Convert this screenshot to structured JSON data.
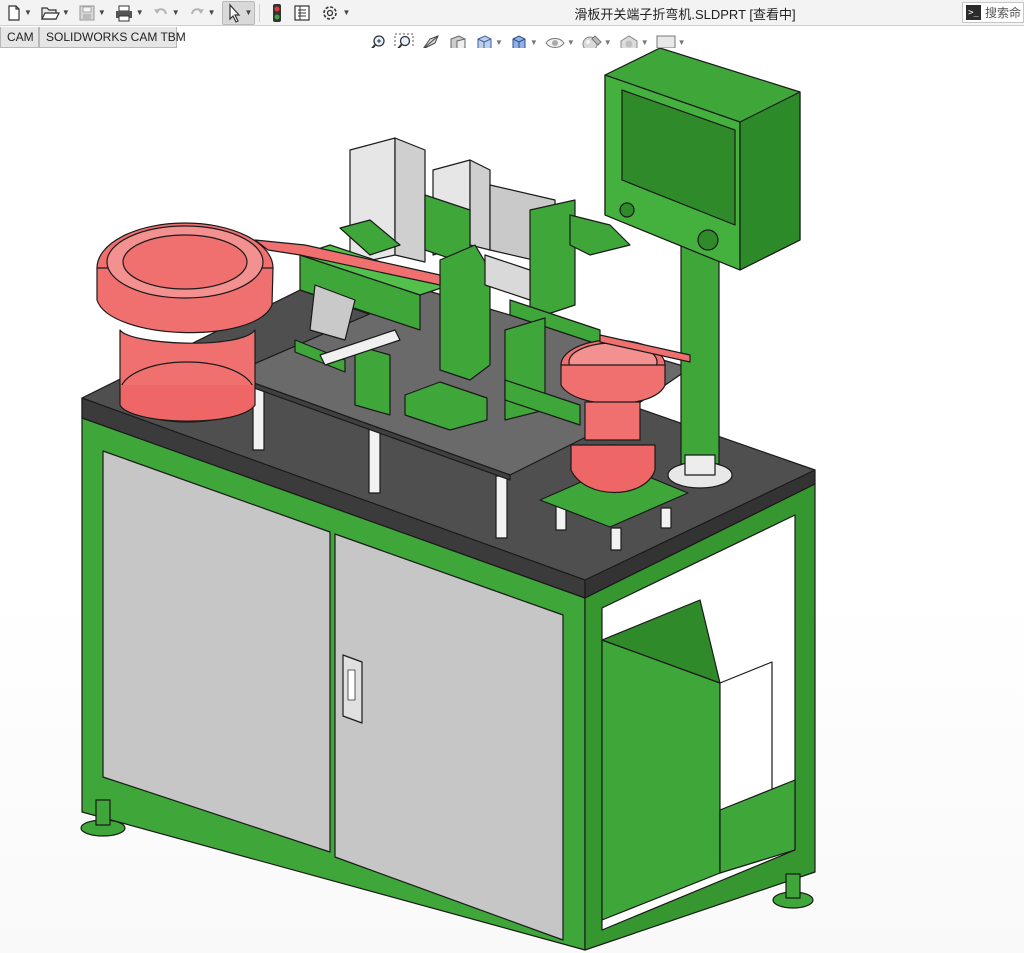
{
  "window": {
    "document_title": "滑板开关端子折弯机.SLDPRT [查看中]"
  },
  "search": {
    "placeholder": "搜索命"
  },
  "quick_access": [
    {
      "name": "new-document-icon"
    },
    {
      "name": "open-document-icon"
    },
    {
      "name": "save-icon"
    },
    {
      "name": "print-icon"
    },
    {
      "name": "undo-icon"
    },
    {
      "name": "redo-icon"
    },
    {
      "name": "select-pointer-icon"
    },
    {
      "name": "rebuild-traffic-light-icon"
    },
    {
      "name": "file-properties-icon"
    },
    {
      "name": "options-gear-icon"
    }
  ],
  "tabs": [
    {
      "label": "CAM"
    },
    {
      "label": "SOLIDWORKS CAM TBM"
    }
  ],
  "headsup_toolbar": [
    {
      "name": "zoom-to-fit-icon"
    },
    {
      "name": "zoom-to-area-icon"
    },
    {
      "name": "previous-view-icon"
    },
    {
      "name": "section-view-icon"
    },
    {
      "name": "view-orientation-icon"
    },
    {
      "name": "display-style-icon"
    },
    {
      "name": "hide-show-items-icon"
    },
    {
      "name": "edit-appearance-icon"
    },
    {
      "name": "apply-scene-icon"
    },
    {
      "name": "view-settings-icon"
    }
  ],
  "colors": {
    "frame_green": "#3fa63a",
    "feeder_red": "#f07070",
    "table_top": "#5c5c5c",
    "cabinet_grey": "#c6c6c6"
  }
}
